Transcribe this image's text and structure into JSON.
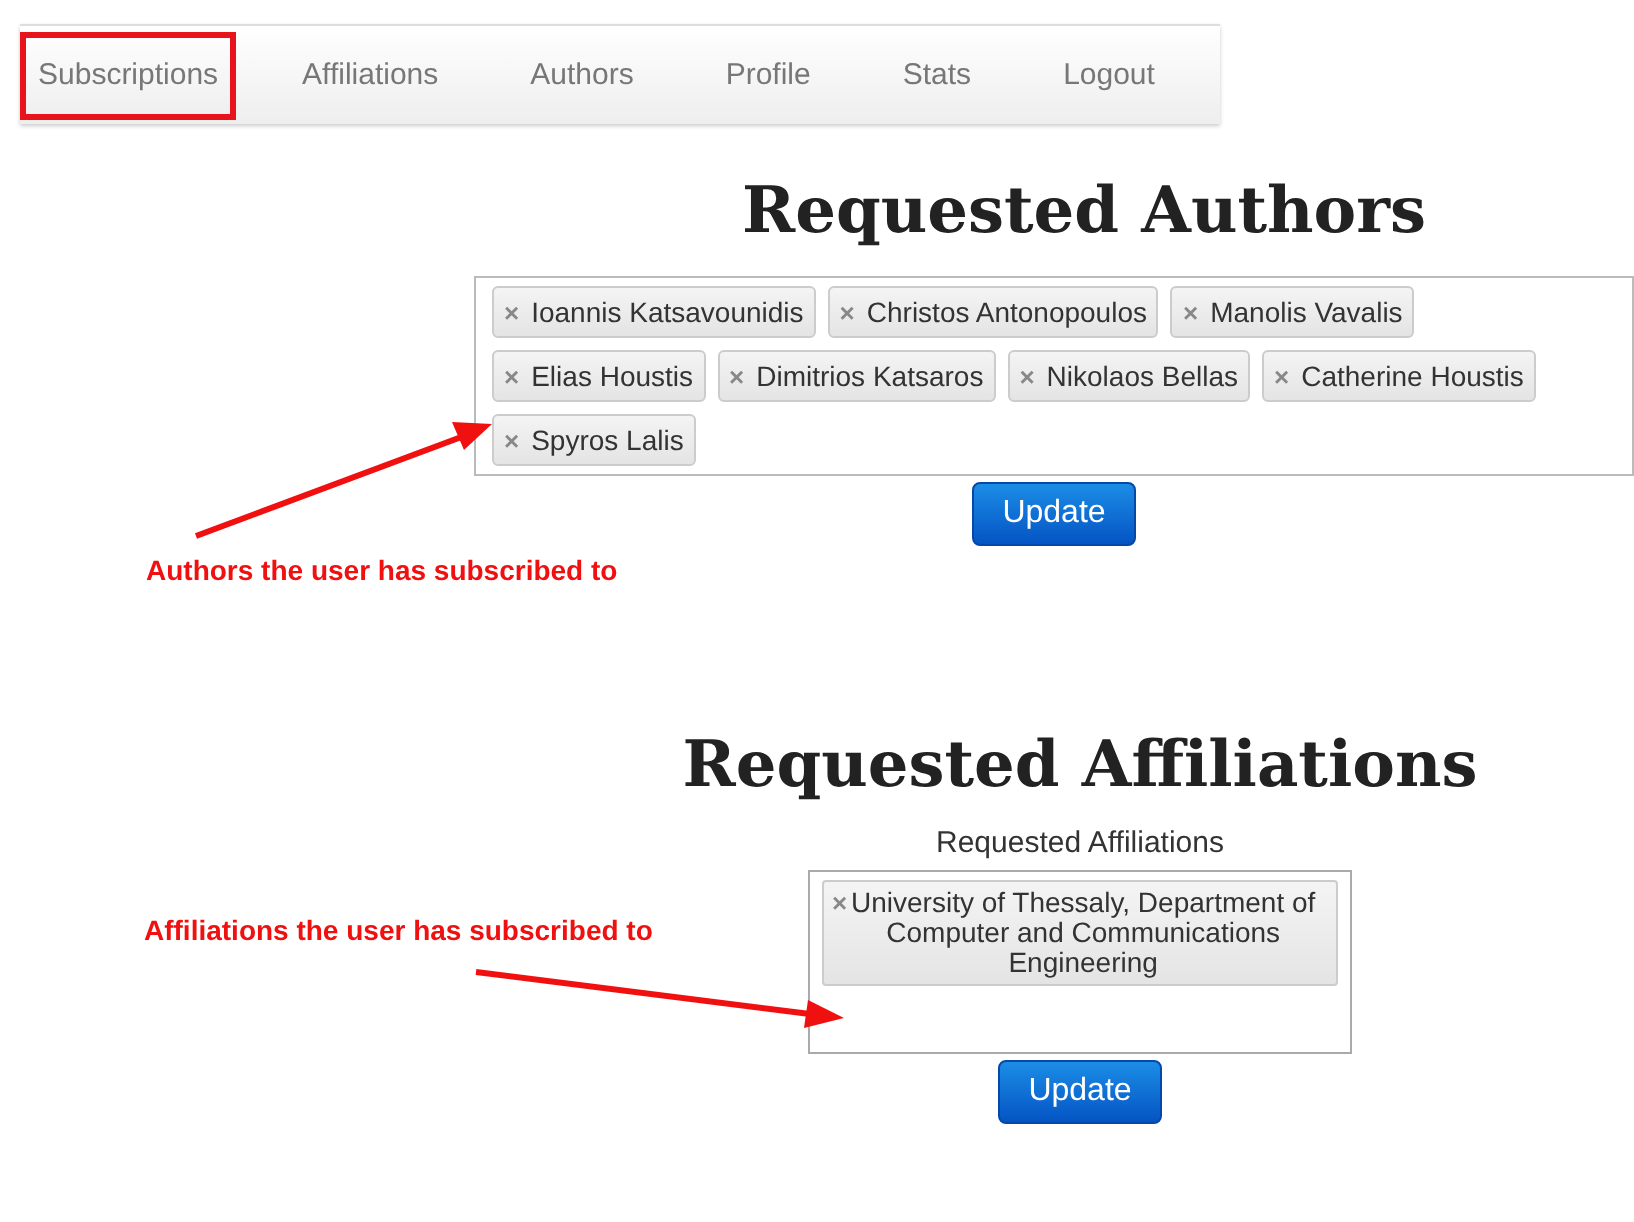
{
  "nav": {
    "tabs": [
      {
        "label": "Subscriptions",
        "selected": true
      },
      {
        "label": "Affiliations",
        "selected": false
      },
      {
        "label": "Authors",
        "selected": false
      },
      {
        "label": "Profile",
        "selected": false
      },
      {
        "label": "Stats",
        "selected": false
      },
      {
        "label": "Logout",
        "selected": false
      }
    ]
  },
  "authors": {
    "title": "Requested Authors",
    "tags": [
      "Ioannis Katsavounidis",
      "Christos Antonopoulos",
      "Manolis Vavalis",
      "Elias Houstis",
      "Dimitrios Katsaros",
      "Nikolaos Bellas",
      "Catherine Houstis",
      "Spyros Lalis"
    ],
    "remove_mark": "×",
    "button": "Update",
    "annotation": "Authors the user has subscribed to"
  },
  "affiliations": {
    "title": "Requested Affiliations",
    "field_label": "Requested Affiliations",
    "tags": [
      "University of Thessaly, Department of Computer and Communications Engineering"
    ],
    "remove_mark": "×",
    "button": "Update",
    "annotation": "Affiliations the user has subscribed to"
  }
}
